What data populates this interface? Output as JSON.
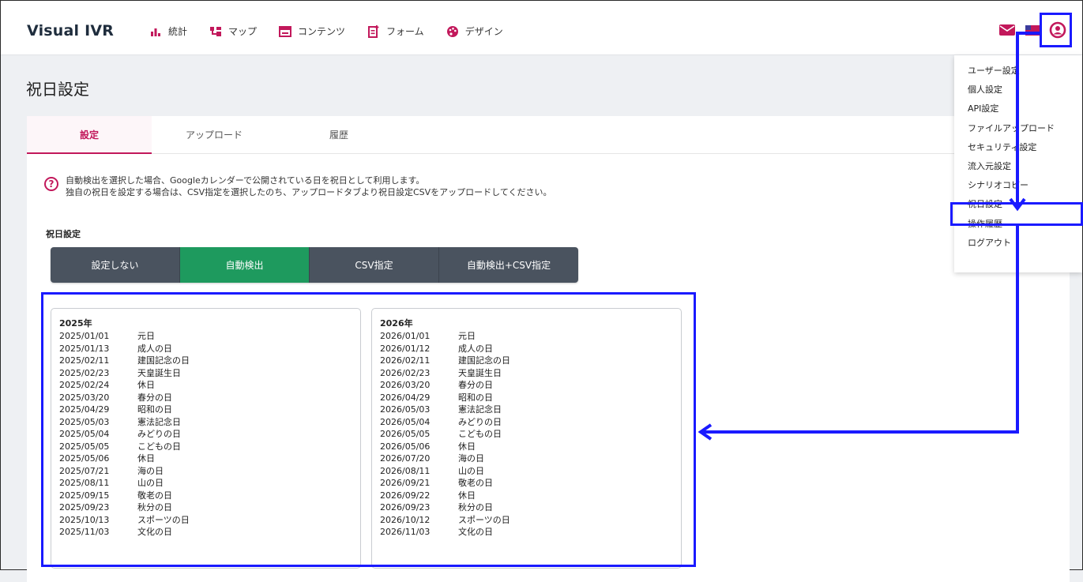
{
  "header": {
    "logo": "Visual IVR",
    "nav": [
      {
        "label": "統計",
        "icon": "stats-icon"
      },
      {
        "label": "マップ",
        "icon": "map-icon"
      },
      {
        "label": "コンテンツ",
        "icon": "contents-icon"
      },
      {
        "label": "フォーム",
        "icon": "form-icon"
      },
      {
        "label": "デザイン",
        "icon": "design-icon"
      }
    ]
  },
  "page": {
    "title": "祝日設定"
  },
  "tabs": [
    "設定",
    "アップロード",
    "履歴"
  ],
  "info": {
    "line1": "自動検出を選択した場合、Googleカレンダーで公開されている日を祝日として利用します。",
    "line2": "独自の祝日を設定する場合は、CSV指定を選択したのち、アップロードタブより祝日設定CSVをアップロードしてください。"
  },
  "holiday_setting": {
    "label": "祝日設定",
    "options": [
      "設定しない",
      "自動検出",
      "CSV指定",
      "自動検出+CSV指定"
    ],
    "selected": "自動検出"
  },
  "holidays_2025": {
    "year": "2025年",
    "rows": [
      [
        "2025/01/01",
        "元日"
      ],
      [
        "2025/01/13",
        "成人の日"
      ],
      [
        "2025/02/11",
        "建国記念の日"
      ],
      [
        "2025/02/23",
        "天皇誕生日"
      ],
      [
        "2025/02/24",
        "休日"
      ],
      [
        "2025/03/20",
        "春分の日"
      ],
      [
        "2025/04/29",
        "昭和の日"
      ],
      [
        "2025/05/03",
        "憲法記念日"
      ],
      [
        "2025/05/04",
        "みどりの日"
      ],
      [
        "2025/05/05",
        "こどもの日"
      ],
      [
        "2025/05/06",
        "休日"
      ],
      [
        "2025/07/21",
        "海の日"
      ],
      [
        "2025/08/11",
        "山の日"
      ],
      [
        "2025/09/15",
        "敬老の日"
      ],
      [
        "2025/09/23",
        "秋分の日"
      ],
      [
        "2025/10/13",
        "スポーツの日"
      ],
      [
        "2025/11/03",
        "文化の日"
      ]
    ]
  },
  "holidays_2026": {
    "year": "2026年",
    "rows": [
      [
        "2026/01/01",
        "元日"
      ],
      [
        "2026/01/12",
        "成人の日"
      ],
      [
        "2026/02/11",
        "建国記念の日"
      ],
      [
        "2026/02/23",
        "天皇誕生日"
      ],
      [
        "2026/03/20",
        "春分の日"
      ],
      [
        "2026/04/29",
        "昭和の日"
      ],
      [
        "2026/05/03",
        "憲法記念日"
      ],
      [
        "2026/05/04",
        "みどりの日"
      ],
      [
        "2026/05/05",
        "こどもの日"
      ],
      [
        "2026/05/06",
        "休日"
      ],
      [
        "2026/07/20",
        "海の日"
      ],
      [
        "2026/08/11",
        "山の日"
      ],
      [
        "2026/09/21",
        "敬老の日"
      ],
      [
        "2026/09/22",
        "休日"
      ],
      [
        "2026/09/23",
        "秋分の日"
      ],
      [
        "2026/10/12",
        "スポーツの日"
      ],
      [
        "2026/11/03",
        "文化の日"
      ]
    ]
  },
  "user_menu": [
    "ユーザー設定",
    "個人設定",
    "API設定",
    "ファイルアップロード",
    "セキュリティ設定",
    "流入元設定",
    "シナリオコピー",
    "祝日設定",
    "操作履歴",
    "ログアウト"
  ],
  "colors": {
    "accent": "#c2185b",
    "selected": "#1e9a5e",
    "annotation": "#1a1aff"
  }
}
